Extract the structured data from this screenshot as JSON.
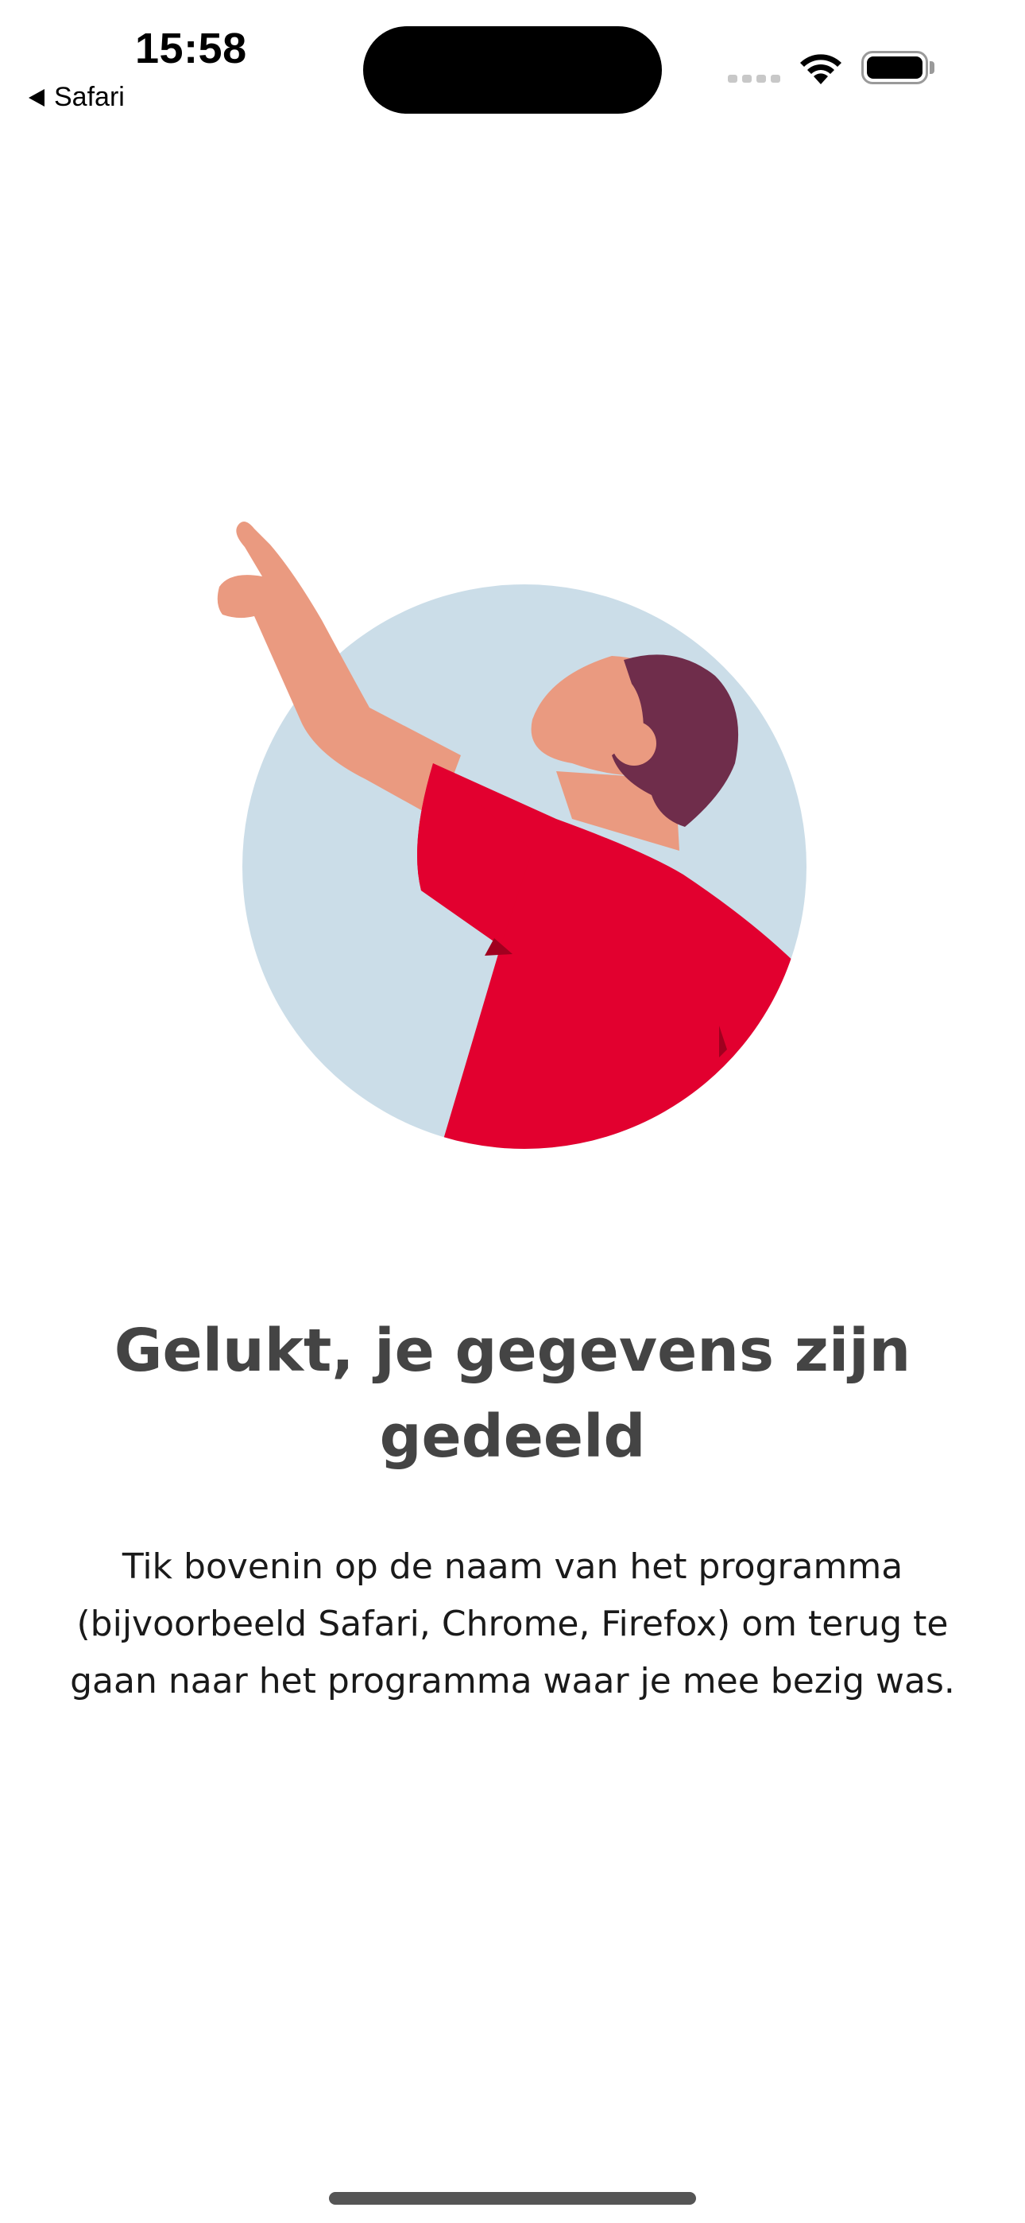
{
  "status_bar": {
    "time": "15:58",
    "back_label": "Safari"
  },
  "illustration": {
    "icon": "person-pointing-up-illustration",
    "colors": {
      "circle": "#cbdde8",
      "shirt": "#e2002f",
      "skin": "#ea9a80",
      "hair": "#6f2d4b"
    }
  },
  "content": {
    "title": "Gelukt, je gegevens zijn gedeeld",
    "body": "Tik bovenin op de naam van het programma (bijvoorbeeld Safari, Chrome, Firefox) om terug te gaan naar het programma waar je mee bezig was."
  }
}
